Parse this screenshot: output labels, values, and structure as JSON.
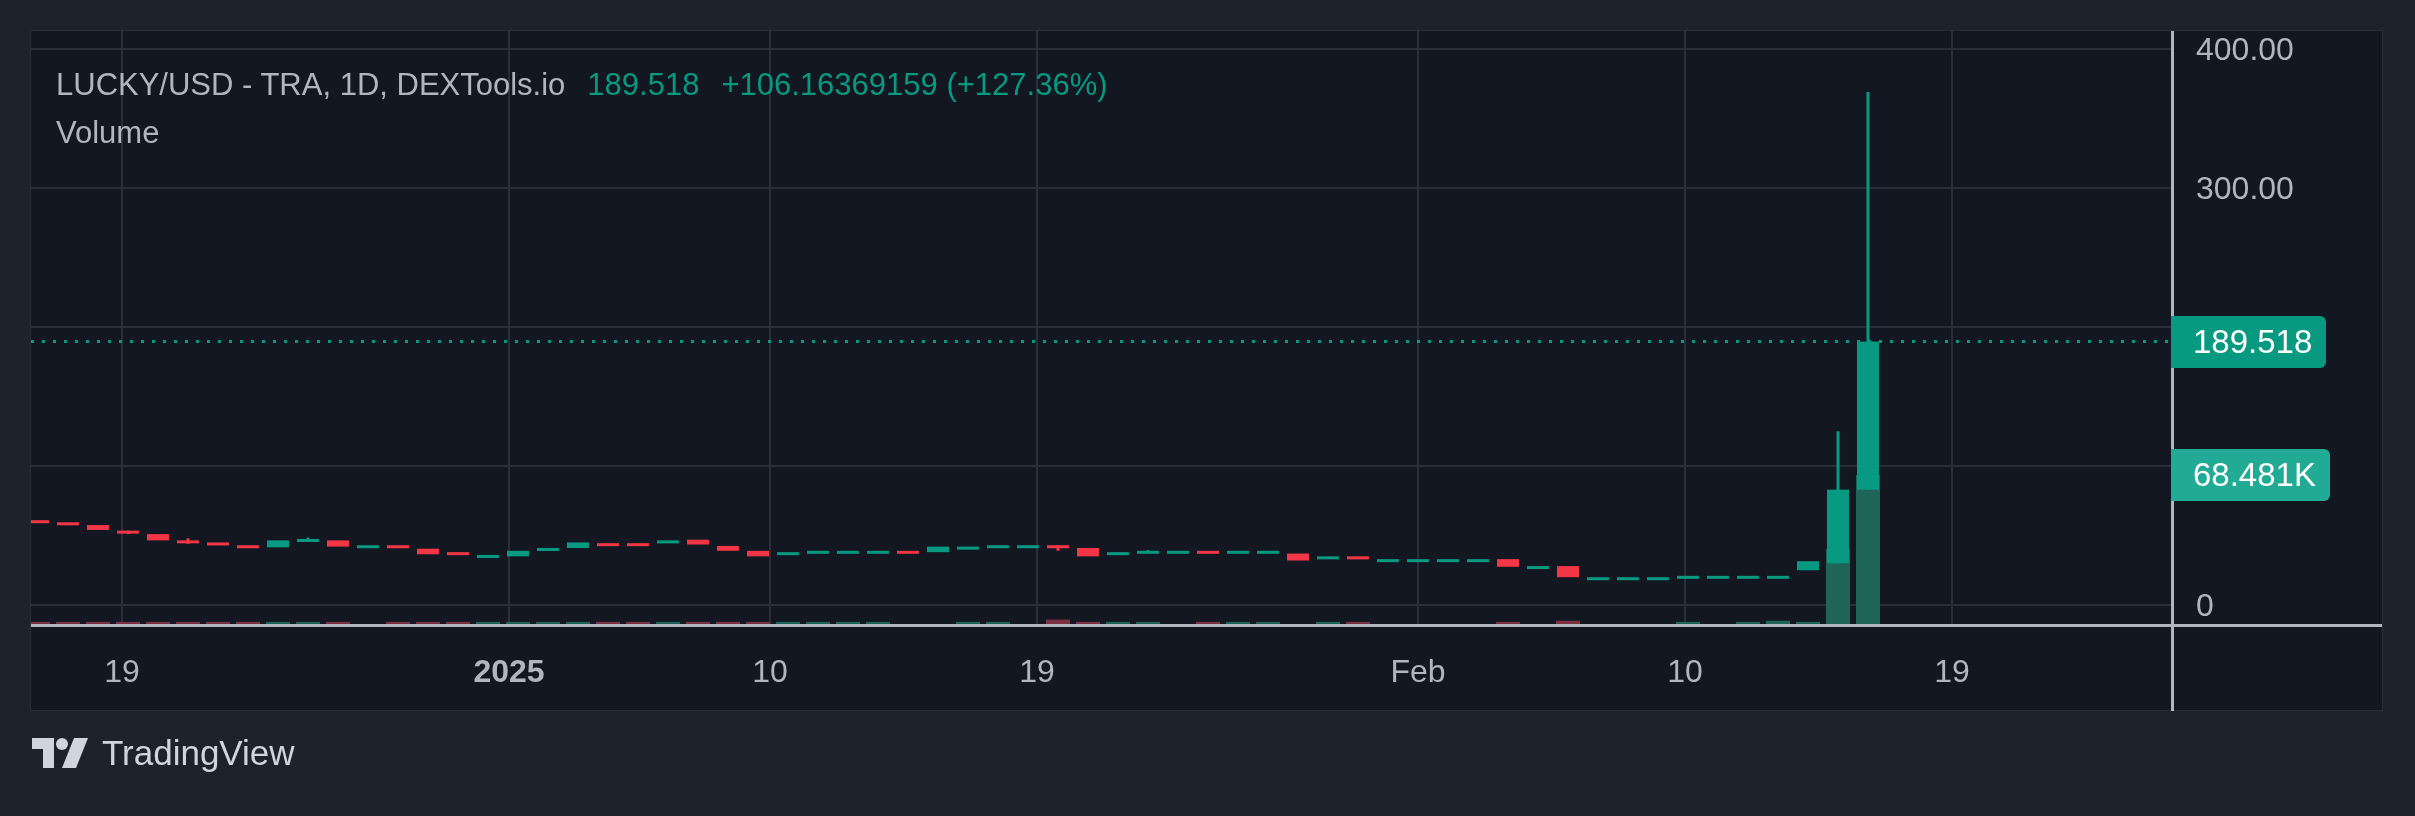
{
  "legend": {
    "symbol": "LUCKY/USD - TRA, 1D, DEXTools.io",
    "last": "189.518",
    "change": "+106.16369159 (+127.36%)",
    "study": "Volume"
  },
  "price_axis": [
    "400.00",
    "300.00",
    "0"
  ],
  "last_price_tag": "189.518",
  "volume_tag": "68.481K",
  "time_axis": [
    {
      "label": "19",
      "bold": false
    },
    {
      "label": "2025",
      "bold": true
    },
    {
      "label": "10",
      "bold": false
    },
    {
      "label": "19",
      "bold": false
    },
    {
      "label": "Feb",
      "bold": false
    },
    {
      "label": "10",
      "bold": false
    },
    {
      "label": "19",
      "bold": false
    }
  ],
  "footer": {
    "brand": "TradingView"
  }
}
